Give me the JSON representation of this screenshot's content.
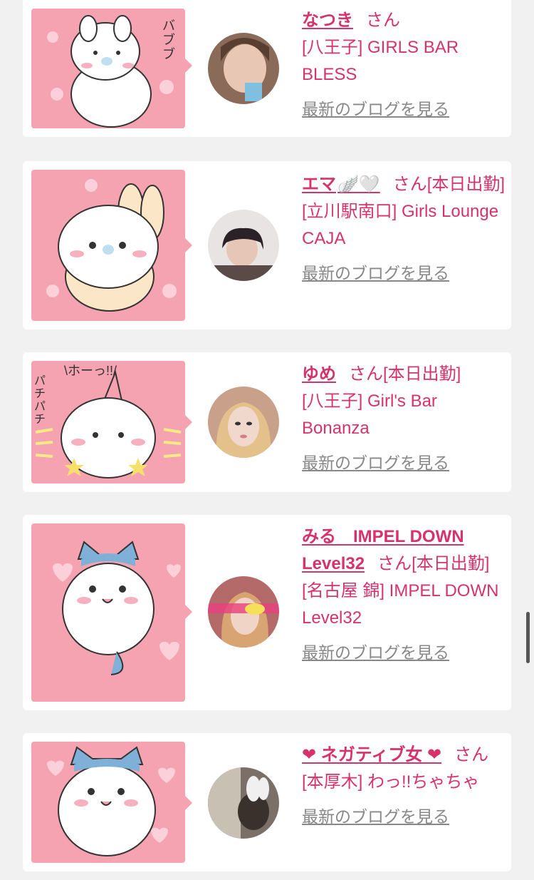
{
  "cards": [
    {
      "name": "なつき",
      "san": "さん",
      "work_status": "",
      "shop": "[八王子] GIRLS BAR BLESS",
      "blog_link": "最新のブログを見る",
      "stamp_text": "バブブ",
      "avatar_color": "#8a6b5a"
    },
    {
      "name": "エマ",
      "name_emoji": "🪽🤍",
      "san": "さん",
      "work_status": "[本日出勤]",
      "shop": "[立川駅南口] Girls Lounge CAJA",
      "blog_link": "最新のブログを見る",
      "avatar_color": "#5a4a48"
    },
    {
      "name": "ゆめ",
      "san": "さん",
      "work_status": "[本日出勤]",
      "shop": "[八王子] Girl's Bar Bonanza",
      "blog_link": "最新のブログを見る",
      "stamp_text_top": "\\ホーっ!!/",
      "stamp_text_side": "パチパチ",
      "avatar_color": "#c9a18a"
    },
    {
      "name": "みる　IMPEL DOWN Level32",
      "san": "さん",
      "work_status": "[本日出勤]",
      "shop": "[名古屋 錦] IMPEL DOWN Level32",
      "blog_link": "最新のブログを見る",
      "avatar_color": "#b56a6a"
    },
    {
      "name": "❤ ネガティブ女 ❤",
      "san": "さん",
      "work_status": "",
      "shop": "[本厚木] わっ!!ちゃちゃ",
      "blog_link": "最新のブログを見る",
      "avatar_color": "#7a7068"
    }
  ],
  "colors": {
    "accent": "#d6336c",
    "stamp_bg": "#f5a3b0",
    "page_bg": "#f1f1f1",
    "link_gray": "#888888"
  },
  "icons": {
    "stamp": "chiikawa-sticker-icon",
    "avatar": "cast-avatar-photo"
  }
}
